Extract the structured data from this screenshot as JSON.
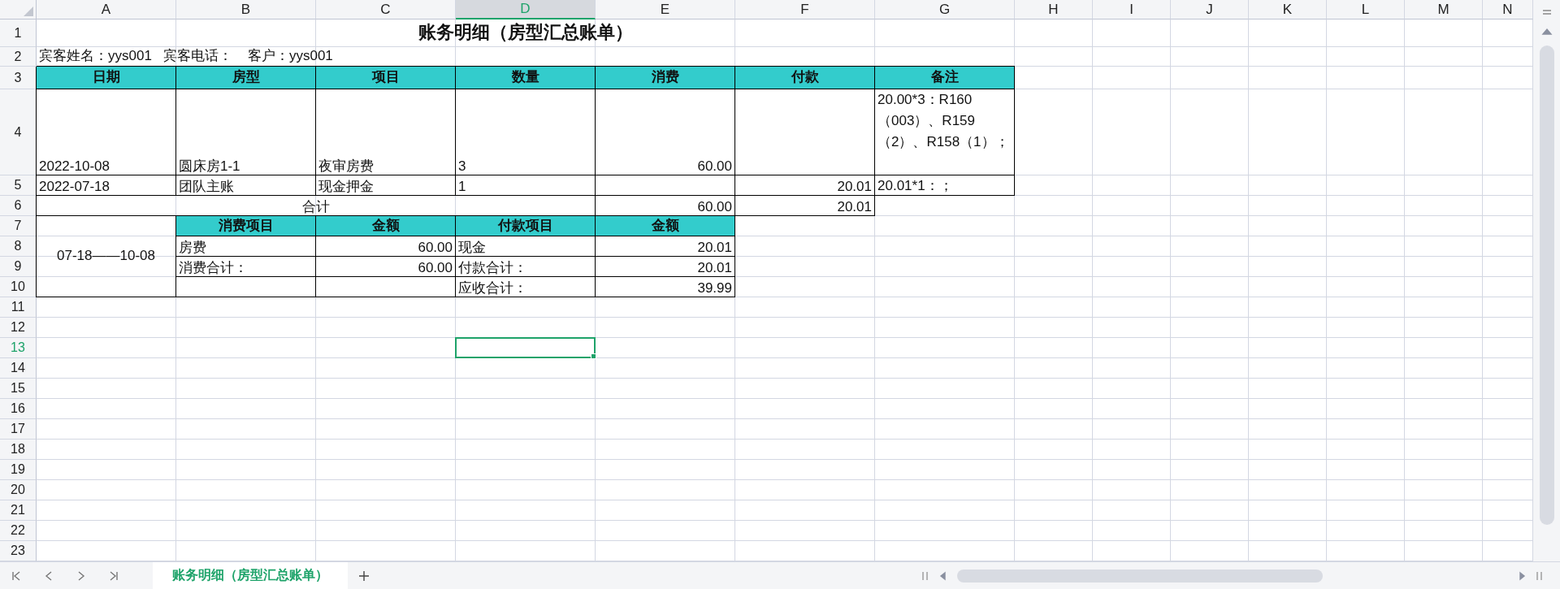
{
  "column_headers": [
    {
      "label": "A",
      "selected": false
    },
    {
      "label": "B",
      "selected": false
    },
    {
      "label": "C",
      "selected": false
    },
    {
      "label": "D",
      "selected": true
    },
    {
      "label": "E",
      "selected": false
    },
    {
      "label": "F",
      "selected": false
    },
    {
      "label": "G",
      "selected": false
    },
    {
      "label": "H",
      "selected": false
    },
    {
      "label": "I",
      "selected": false
    },
    {
      "label": "J",
      "selected": false
    },
    {
      "label": "K",
      "selected": false
    },
    {
      "label": "L",
      "selected": false
    },
    {
      "label": "M",
      "selected": false
    },
    {
      "label": "N",
      "selected": false
    }
  ],
  "row_headers": [
    {
      "label": "1",
      "selected": false
    },
    {
      "label": "2",
      "selected": false
    },
    {
      "label": "3",
      "selected": false
    },
    {
      "label": "4",
      "selected": false
    },
    {
      "label": "5",
      "selected": false
    },
    {
      "label": "6",
      "selected": false
    },
    {
      "label": "7",
      "selected": false
    },
    {
      "label": "8",
      "selected": false
    },
    {
      "label": "9",
      "selected": false
    },
    {
      "label": "10",
      "selected": false
    },
    {
      "label": "11",
      "selected": false
    },
    {
      "label": "12",
      "selected": false
    },
    {
      "label": "13",
      "selected": true
    },
    {
      "label": "14",
      "selected": false
    },
    {
      "label": "15",
      "selected": false
    },
    {
      "label": "16",
      "selected": false
    },
    {
      "label": "17",
      "selected": false
    },
    {
      "label": "18",
      "selected": false
    },
    {
      "label": "19",
      "selected": false
    },
    {
      "label": "20",
      "selected": false
    },
    {
      "label": "21",
      "selected": false
    },
    {
      "label": "22",
      "selected": false
    },
    {
      "label": "23",
      "selected": false
    }
  ],
  "title": "账务明细（房型汇总账单）",
  "guest_info": "宾客姓名：yys001   宾客电话：    客户：yys001",
  "detail_table": {
    "columns": [
      "日期",
      "房型",
      "项目",
      "数量",
      "消费",
      "付款",
      "备注"
    ],
    "rows": [
      {
        "date": "2022-10-08",
        "room_type": "圆床房1-1",
        "item": "夜审房费",
        "quantity": "3",
        "consumption": "60.00",
        "remark": "20.00*3：R160（003）、R159（2）、R158（1）；"
      },
      {
        "date": "2022-07-18",
        "room_type": "团队主账",
        "item": "现金押金",
        "quantity": "1",
        "payment": "20.01",
        "remark": "20.01*1：；"
      }
    ]
  },
  "total": {
    "label": "合计",
    "consumption": "60.00",
    "payment": "20.01"
  },
  "summary": {
    "period": "07-18——10-08",
    "columns": [
      "消费项目",
      "金额",
      "付款项目",
      "金额"
    ],
    "rows": [
      {
        "consumption_item": "房费",
        "consumption_amount": "60.00",
        "payment_item": "现金",
        "payment_amount": "20.01"
      },
      {
        "consumption_item": "消费合计：",
        "consumption_amount": "60.00",
        "payment_item": "付款合计：",
        "payment_amount": "20.01"
      },
      {
        "payment_item": "应收合计：",
        "payment_amount": "39.99"
      }
    ]
  },
  "sheet_tabs": [
    {
      "label": "账务明细（房型汇总账单）",
      "selected": true
    }
  ]
}
